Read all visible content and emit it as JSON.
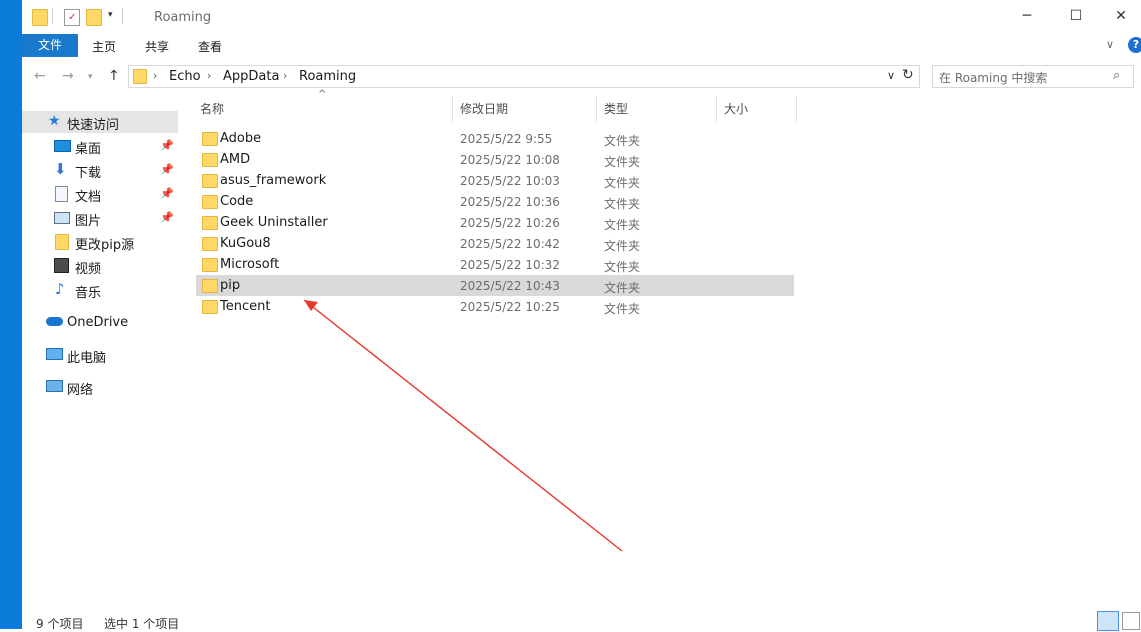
{
  "window": {
    "title": "Roaming"
  },
  "ribbon": {
    "tabs": [
      "文件",
      "主页",
      "共享",
      "查看"
    ]
  },
  "address": {
    "crumbs": [
      "Echo",
      "AppData",
      "Roaming"
    ],
    "search_placeholder": "在 Roaming 中搜索"
  },
  "nav_pane": {
    "quick_access": "快速访问",
    "items": [
      "桌面",
      "下载",
      "文档",
      "图片",
      "更改pip源",
      "视频",
      "音乐"
    ],
    "onedrive": "OneDrive",
    "this_pc": "此电脑",
    "network": "网络"
  },
  "columns": [
    "名称",
    "修改日期",
    "类型",
    "大小"
  ],
  "files": [
    {
      "name": "Adobe",
      "date": "2025/5/22 9:55",
      "type": "文件夹"
    },
    {
      "name": "AMD",
      "date": "2025/5/22 10:08",
      "type": "文件夹"
    },
    {
      "name": "asus_framework",
      "date": "2025/5/22 10:03",
      "type": "文件夹"
    },
    {
      "name": "Code",
      "date": "2025/5/22 10:36",
      "type": "文件夹"
    },
    {
      "name": "Geek Uninstaller",
      "date": "2025/5/22 10:26",
      "type": "文件夹"
    },
    {
      "name": "KuGou8",
      "date": "2025/5/22 10:42",
      "type": "文件夹"
    },
    {
      "name": "Microsoft",
      "date": "2025/5/22 10:32",
      "type": "文件夹"
    },
    {
      "name": "pip",
      "date": "2025/5/22 10:43",
      "type": "文件夹",
      "selected": true
    },
    {
      "name": "Tencent",
      "date": "2025/5/22 10:25",
      "type": "文件夹"
    }
  ],
  "status": {
    "count": "9 个项目",
    "selected": "选中 1 个项目"
  },
  "colors": {
    "accent": "#1979ca",
    "folder": "#ffd866",
    "selection": "#d9d9d9",
    "annotation_arrow": "#e8382b"
  }
}
